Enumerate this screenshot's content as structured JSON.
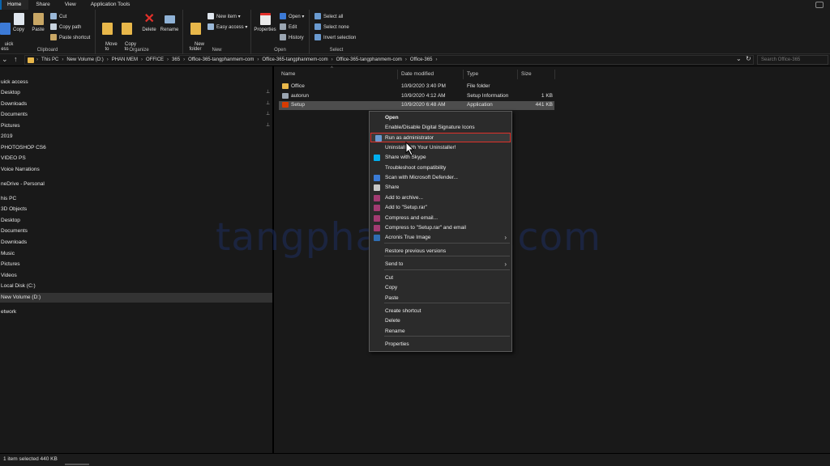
{
  "tabs": [
    "Home",
    "Share",
    "View",
    "Application Tools"
  ],
  "ribbon": {
    "clipboard": {
      "quick_label": "uick\ness",
      "copy": "Copy",
      "paste": "Paste",
      "cut": "Cut",
      "copy_path": "Copy path",
      "paste_shortcut": "Paste shortcut",
      "group": "Clipboard"
    },
    "organize": {
      "move_to": "Move\nto",
      "copy_to": "Copy\nto",
      "delete": "Delete",
      "rename": "Rename",
      "group": "Organize"
    },
    "new": {
      "new_folder": "New\nfolder",
      "new_item": "New item ▾",
      "easy_access": "Easy access ▾",
      "group": "New"
    },
    "open": {
      "properties": "Properties",
      "open": "Open ▾",
      "edit": "Edit",
      "history": "History",
      "group": "Open"
    },
    "select": {
      "select_all": "Select all",
      "select_none": "Select none",
      "invert_selection": "Invert selection",
      "group": "Select"
    }
  },
  "address": {
    "crumbs": [
      "This PC",
      "New Volume (D:)",
      "PHAN MEM",
      "OFFICE",
      "365",
      "Office-365-tangphanmem-com",
      "Office-365-tangphanmem-com",
      "Office-365-tangphanmem-com",
      "Office-365"
    ],
    "search_placeholder": "Search Office-365"
  },
  "nav": {
    "items": [
      {
        "label": "uick access",
        "pinned": false
      },
      {
        "label": "Desktop",
        "pinned": true
      },
      {
        "label": "Downloads",
        "pinned": true
      },
      {
        "label": "Documents",
        "pinned": true
      },
      {
        "label": "Pictures",
        "pinned": true
      },
      {
        "label": "2019",
        "pinned": false
      },
      {
        "label": "PHOTOSHOP CS6",
        "pinned": false
      },
      {
        "label": "VIDEO PS",
        "pinned": false
      },
      {
        "label": "Voice Narrations",
        "pinned": false
      },
      {
        "label": "neDrive - Personal",
        "pinned": false
      },
      {
        "label": "his PC",
        "pinned": false
      },
      {
        "label": "3D Objects",
        "pinned": false
      },
      {
        "label": "Desktop",
        "pinned": false
      },
      {
        "label": "Documents",
        "pinned": false
      },
      {
        "label": "Downloads",
        "pinned": false
      },
      {
        "label": "Music",
        "pinned": false
      },
      {
        "label": "Pictures",
        "pinned": false
      },
      {
        "label": "Videos",
        "pinned": false
      },
      {
        "label": "Local Disk (C:)",
        "pinned": false
      },
      {
        "label": "New Volume (D:)",
        "pinned": false
      },
      {
        "label": "etwork",
        "pinned": false
      }
    ],
    "pin_glyph": "📌"
  },
  "files": {
    "headers": {
      "name": "Name",
      "date": "Date modified",
      "type": "Type",
      "size": "Size"
    },
    "rows": [
      {
        "name": "Office",
        "date": "10/9/2020 3:40 PM",
        "type": "File folder",
        "size": "",
        "icon": "folder-icon",
        "color": "#e8b74a"
      },
      {
        "name": "autorun",
        "date": "10/9/2020 4:12 AM",
        "type": "Setup Information",
        "size": "1 KB",
        "icon": "settings-file-icon",
        "color": "#9aa5b1"
      },
      {
        "name": "Setup",
        "date": "10/9/2020 6:48 AM",
        "type": "Application",
        "size": "441 KB",
        "icon": "office-setup-icon",
        "color": "#d83b01"
      }
    ]
  },
  "context_menu": {
    "items": [
      {
        "label": "Open",
        "bold": true
      },
      {
        "label": "Enable/Disable Digital Signature Icons"
      },
      {
        "label": "Run as administrator",
        "highlight": true,
        "icon": "shield-icon"
      },
      {
        "label": "Uninstall with Your Uninstaller!"
      },
      {
        "label": "Share with Skype",
        "icon": "skype-icon"
      },
      {
        "label": "Troubleshoot compatibility"
      },
      {
        "label": "Scan with Microsoft Defender...",
        "icon": "defender-icon"
      },
      {
        "label": "Share",
        "icon": "share-icon"
      },
      {
        "label": "Add to archive...",
        "icon": "winrar-icon"
      },
      {
        "label": "Add to \"Setup.rar\"",
        "icon": "winrar-icon"
      },
      {
        "label": "Compress and email...",
        "icon": "winrar-icon"
      },
      {
        "label": "Compress to \"Setup.rar\" and email",
        "icon": "winrar-icon"
      },
      {
        "label": "Acronis True Image",
        "icon": "acronis-icon",
        "submenu": true
      },
      {
        "label": "Restore previous versions"
      },
      {
        "label": "Send to",
        "submenu": true
      },
      {
        "label": "Cut"
      },
      {
        "label": "Copy"
      },
      {
        "label": "Paste"
      },
      {
        "label": "Create shortcut"
      },
      {
        "label": "Delete"
      },
      {
        "label": "Rename"
      },
      {
        "label": "Properties"
      }
    ]
  },
  "watermark": "tangphanmem.com",
  "status": {
    "text": "1 item selected  440 KB"
  },
  "colors": {
    "accent": "#0a64ad",
    "highlight_border": "#e0312a",
    "folder": "#e8b74a",
    "background": "#191919"
  }
}
